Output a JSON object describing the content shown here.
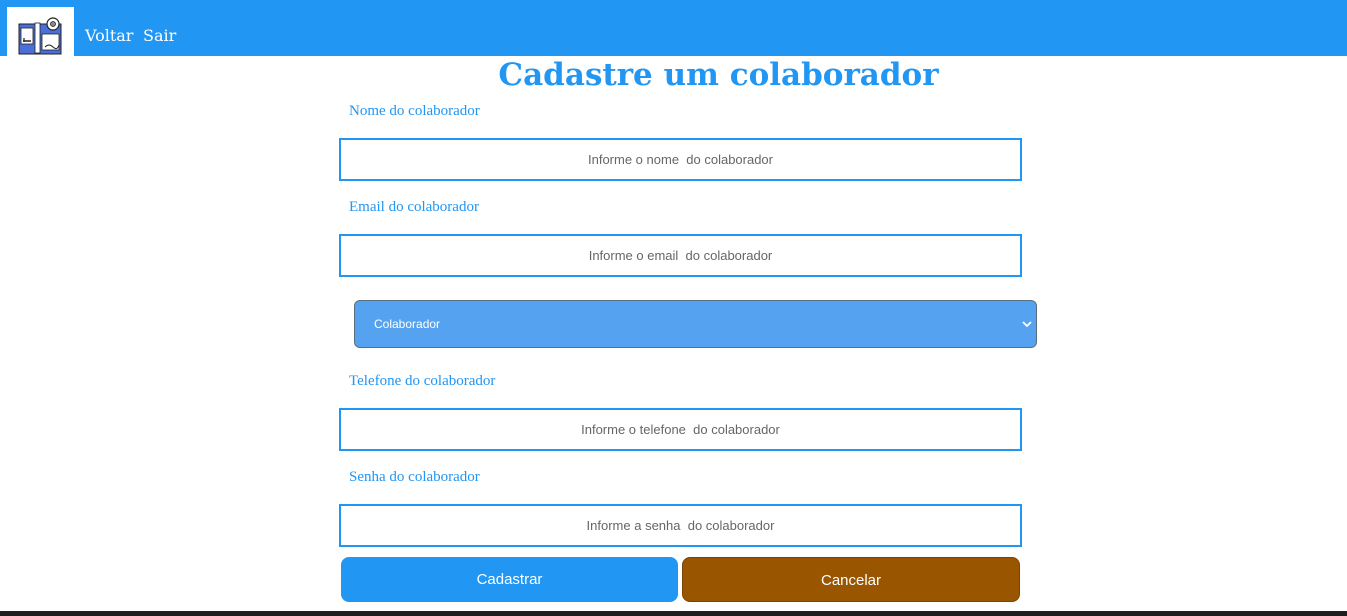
{
  "navbar": {
    "logo_icon": "app-logo-icon",
    "links": [
      "Voltar",
      "Sair"
    ],
    "background": "#2196f3"
  },
  "page": {
    "title": "Cadastre um colaborador"
  },
  "form": {
    "name": {
      "label": "Nome do colaborador",
      "placeholder": "Informe o nome  do colaborador",
      "value": ""
    },
    "email": {
      "label": "Email do colaborador",
      "placeholder": "Informe o email  do colaborador",
      "value": ""
    },
    "role": {
      "selected": "Colaborador",
      "icon": "chevron-down-icon"
    },
    "phone": {
      "label": "Telefone do colaborador",
      "placeholder": "Informe o telefone  do colaborador",
      "value": ""
    },
    "password": {
      "label": "Senha do colaborador",
      "placeholder": "Informe a senha  do colaborador",
      "value": ""
    }
  },
  "actions": {
    "submit_label": "Cadastrar",
    "cancel_label": "Cancelar",
    "submit_color": "#2196f3",
    "cancel_color": "#995500"
  }
}
